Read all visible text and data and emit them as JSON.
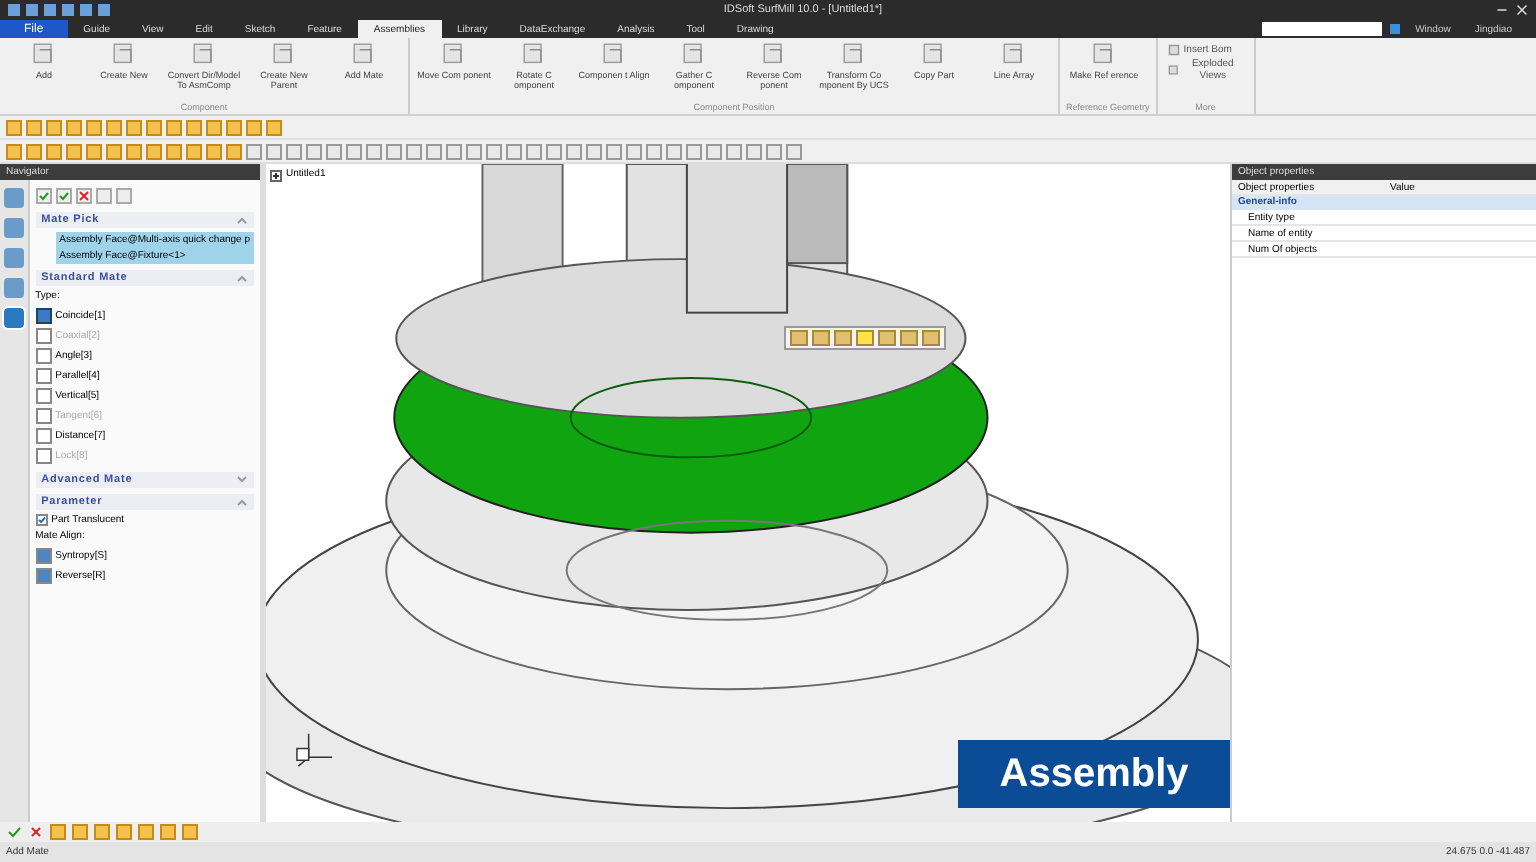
{
  "window": {
    "title": "IDSoft SurfMill 10.0 - [Untitled1*]",
    "menu_window": "Window",
    "user": "Jingdiao"
  },
  "menu_tabs": [
    {
      "label": "File",
      "kind": "file",
      "selected": false
    },
    {
      "label": "Guide",
      "kind": "tab",
      "selected": false
    },
    {
      "label": "View",
      "kind": "tab",
      "selected": false
    },
    {
      "label": "Edit",
      "kind": "tab",
      "selected": false
    },
    {
      "label": "Sketch",
      "kind": "tab",
      "selected": false
    },
    {
      "label": "Feature",
      "kind": "tab",
      "selected": false
    },
    {
      "label": "Assemblies",
      "kind": "tab",
      "selected": true
    },
    {
      "label": "Library",
      "kind": "tab",
      "selected": false
    },
    {
      "label": "DataExchange",
      "kind": "tab",
      "selected": false
    },
    {
      "label": "Analysis",
      "kind": "tab",
      "selected": false
    },
    {
      "label": "Tool",
      "kind": "tab",
      "selected": false
    },
    {
      "label": "Drawing",
      "kind": "tab",
      "selected": false
    }
  ],
  "ribbon_groups": [
    {
      "name": "Component",
      "kind": "large",
      "buttons": [
        "Add",
        "Create New",
        "Convert Dir/Model To AsmComp",
        "Create New Parent",
        "Add Mate"
      ]
    },
    {
      "name": "Component Position",
      "kind": "large",
      "buttons": [
        "Move Com ponent",
        "Rotate C omponent",
        "Componen t Align",
        "Gather C omponent",
        "Reverse Com ponent",
        "Transform Co mponent By UCS",
        "Copy Part",
        "Line Array"
      ]
    },
    {
      "name": "Reference Geometry",
      "kind": "large",
      "buttons": [
        "Make Ref erence"
      ]
    },
    {
      "name": "More",
      "kind": "small",
      "buttons": [
        "Insert Bom",
        "Exploded Views"
      ]
    }
  ],
  "navigator": {
    "title": "Navigator",
    "sections": [
      {
        "title": "Mate Pick",
        "kind": "pick",
        "expanded": true,
        "items": [
          "Assembly Face@Multi-axis quick change p",
          "Assembly Face@Fixture<1>"
        ]
      },
      {
        "title": "Standard Mate",
        "kind": "types",
        "expanded": true,
        "label": "Type:",
        "items": [
          {
            "label": "Coincide[1]",
            "disabled": false,
            "selected": true
          },
          {
            "label": "Coaxial[2]",
            "disabled": true,
            "selected": false
          },
          {
            "label": "Angle[3]",
            "disabled": false,
            "selected": false
          },
          {
            "label": "Parallel[4]",
            "disabled": false,
            "selected": false
          },
          {
            "label": "Vertical[5]",
            "disabled": false,
            "selected": false
          },
          {
            "label": "Tangent[6]",
            "disabled": true,
            "selected": false
          },
          {
            "label": "Distance[7]",
            "disabled": false,
            "selected": false
          },
          {
            "label": "Lock[8]",
            "disabled": true,
            "selected": false
          }
        ]
      },
      {
        "title": "Advanced Mate",
        "expanded": false
      },
      {
        "title": "Parameter",
        "kind": "params",
        "expanded": true,
        "checkbox": {
          "label": "Part Translucent",
          "checked": true
        },
        "label": "Mate Align:",
        "items": [
          "Syntropy[S]",
          "Reverse[R]"
        ]
      }
    ]
  },
  "viewport": {
    "tree_root": "Untitled1",
    "overlay_caption": "Assembly"
  },
  "properties": {
    "title": "Object properties",
    "columns": [
      "Object properties",
      "Value"
    ],
    "group": "General-info",
    "rows": [
      "Entity type",
      "Name of entity",
      "Num Of objects"
    ]
  },
  "status_bar": {
    "prompt": "Add Mate",
    "coordinates": "24.675 0.0 -41.487"
  }
}
